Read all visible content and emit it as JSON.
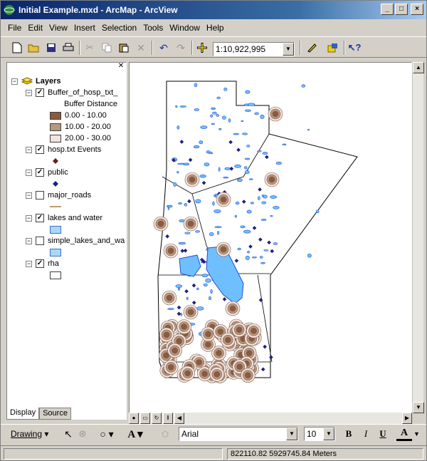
{
  "window": {
    "title": "Initial Example.mxd - ArcMap - ArcView",
    "minimize": "_",
    "maximize": "□",
    "close": "×"
  },
  "menu": [
    "File",
    "Edit",
    "View",
    "Insert",
    "Selection",
    "Tools",
    "Window",
    "Help"
  ],
  "toolbar": {
    "scale": "1:10,922,995"
  },
  "toc": {
    "root": "Layers",
    "layers": [
      {
        "name": "Buffer_of_hosp_txt_",
        "checked": true,
        "legend_title": "Buffer Distance",
        "classes": [
          {
            "label": "0.00 - 10.00",
            "color": "#8b5a3c"
          },
          {
            "label": "10.00 - 20.00",
            "color": "#b89780"
          },
          {
            "label": "20.00 - 30.00",
            "color": "#f2e3dc"
          }
        ]
      },
      {
        "name": "hosp.txt Events",
        "checked": true
      },
      {
        "name": "public",
        "checked": true
      },
      {
        "name": "major_roads",
        "checked": false
      },
      {
        "name": "lakes and water",
        "checked": true
      },
      {
        "name": "simple_lakes_and_wa",
        "checked": false
      },
      {
        "name": "rha",
        "checked": true
      }
    ],
    "tabs": [
      "Display",
      "Source"
    ]
  },
  "drawing": {
    "label": "Drawing",
    "font": "Arial",
    "size": "10",
    "bold": "B",
    "italic": "I",
    "underline": "U",
    "font_color": "A"
  },
  "status": {
    "coords": "822110.82  5929745.84 Meters"
  },
  "colors": {
    "water": "#6fbfff",
    "water_edge": "#2050d0",
    "point": "#202080",
    "buffer": "#8b5a3c"
  }
}
